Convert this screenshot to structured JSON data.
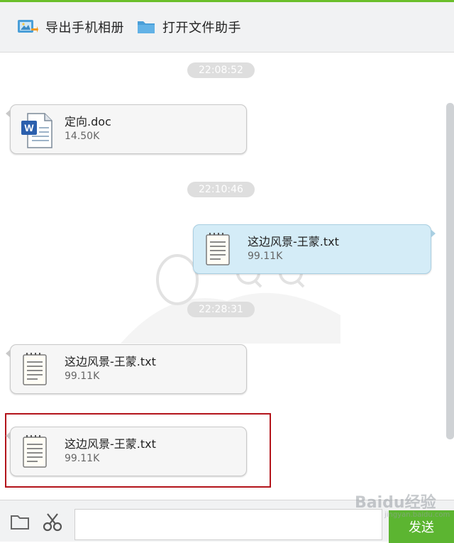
{
  "toolbar": {
    "export_label": "导出手机相册",
    "open_assistant_label": "打开文件助手"
  },
  "messages": [
    {
      "time": "22:08:52",
      "direction": "incoming",
      "file_type": "word-doc",
      "file_name": "定向.doc",
      "file_size": "14.50K"
    },
    {
      "time": "22:10:46",
      "direction": "outgoing",
      "file_type": "txt",
      "file_name": "这边风景-王蒙.txt",
      "file_size": "99.11K"
    },
    {
      "time": "22:28:31",
      "direction": "incoming",
      "file_type": "txt",
      "file_name": "这边风景-王蒙.txt",
      "file_size": "99.11K"
    },
    {
      "time": "",
      "direction": "incoming",
      "file_type": "txt",
      "file_name": "这边风景-王蒙.txt",
      "file_size": "99.11K",
      "highlighted": true
    }
  ],
  "input": {
    "send_label": "发送",
    "folder_icon": "folder-icon",
    "scissors_icon": "scissors-icon"
  },
  "watermark": {
    "logo": "Baidu经验",
    "url": "jingyan.baidu.com"
  },
  "colors": {
    "accent_green": "#5cb531",
    "outgoing_bubble": "#d4ecf7",
    "incoming_bubble": "#f6f6f6",
    "highlight_border": "#b3141b",
    "timestamp_pill": "#dedede"
  }
}
